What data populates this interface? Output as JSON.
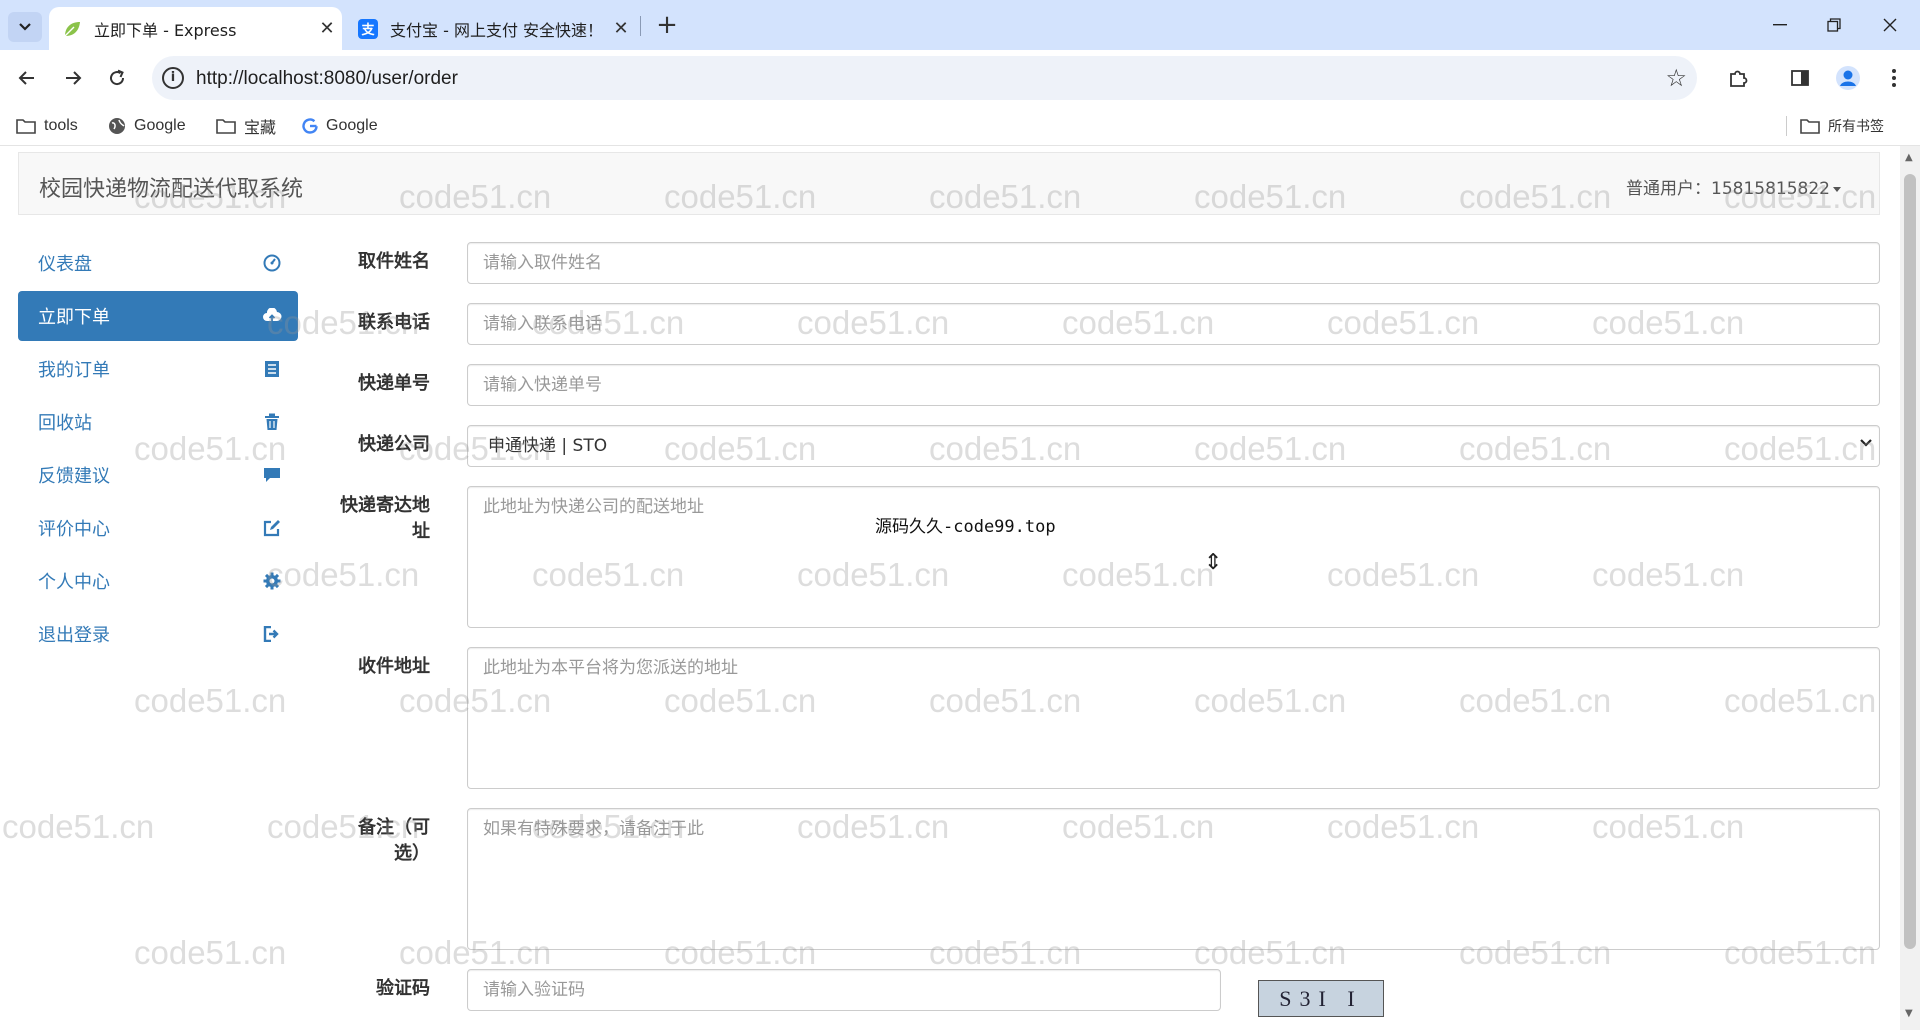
{
  "browser": {
    "tabs": [
      {
        "title": "立即下单 - Express",
        "icon": "leaf-icon",
        "active": true
      },
      {
        "title": "支付宝 - 网上支付 安全快速！",
        "icon": "alipay-icon",
        "active": false
      }
    ],
    "new_tab": "+",
    "url": "http://localhost:8080/user/order",
    "bookmarks": [
      {
        "label": "tools",
        "icon": "folder-icon"
      },
      {
        "label": "Google",
        "icon": "globe-icon"
      },
      {
        "label": "宝藏",
        "icon": "folder-icon"
      },
      {
        "label": "Google",
        "icon": "google-icon"
      }
    ],
    "all_bookmarks": "所有书签"
  },
  "app": {
    "brand": "校园快递物流配送代取系统",
    "user_label": "普通用户：",
    "user_phone": "15815815822"
  },
  "sidebar": {
    "items": [
      {
        "label": "仪表盘",
        "icon": "dashboard-icon",
        "active": false
      },
      {
        "label": "立即下单",
        "icon": "cloud-upload-icon",
        "active": true
      },
      {
        "label": "我的订单",
        "icon": "list-icon",
        "active": false
      },
      {
        "label": "回收站",
        "icon": "trash-icon",
        "active": false
      },
      {
        "label": "反馈建议",
        "icon": "comment-icon",
        "active": false
      },
      {
        "label": "评价中心",
        "icon": "edit-icon",
        "active": false
      },
      {
        "label": "个人中心",
        "icon": "cog-icon",
        "active": false
      },
      {
        "label": "退出登录",
        "icon": "logout-icon",
        "active": false
      }
    ]
  },
  "form": {
    "name": {
      "label": "取件姓名",
      "placeholder": "请输入取件姓名"
    },
    "phone": {
      "label": "联系电话",
      "placeholder": "请输入联系电话"
    },
    "tracking": {
      "label": "快递单号",
      "placeholder": "请输入快递单号"
    },
    "company": {
      "label": "快递公司",
      "value": "申通快递 | STO"
    },
    "delivery_address": {
      "label_line1": "快递寄达地",
      "label_line2": "址",
      "placeholder": "此地址为快递公司的配送地址"
    },
    "receive_address": {
      "label": "收件地址",
      "placeholder": "此地址为本平台将为您派送的地址"
    },
    "remark": {
      "label_line1": "备注（可",
      "label_line2": "选）",
      "placeholder": "如果有特殊要求，请备注于此"
    },
    "captcha": {
      "label": "验证码",
      "placeholder": "请输入验证码",
      "image_text": "S3I I"
    }
  },
  "overlay_text": "源码久久-code99.top",
  "watermark": "code51.cn"
}
